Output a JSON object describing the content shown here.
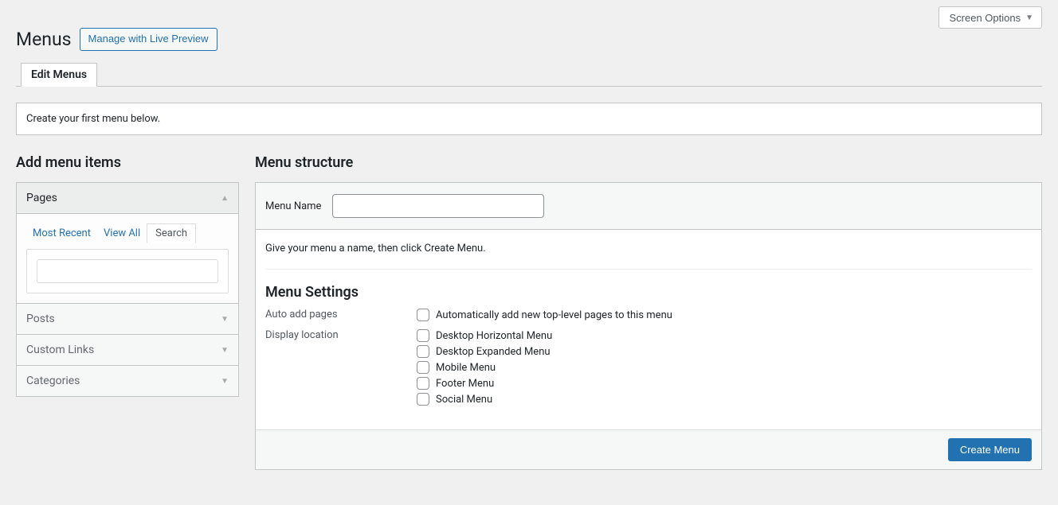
{
  "screen_options": {
    "label": "Screen Options"
  },
  "page": {
    "title": "Menus",
    "live_preview_button": "Manage with Live Preview"
  },
  "tabs": {
    "edit": "Edit Menus"
  },
  "notice": "Create your first menu below.",
  "left": {
    "title": "Add menu items",
    "pages": {
      "label": "Pages",
      "inner_tabs": {
        "recent": "Most Recent",
        "view_all": "View All",
        "search": "Search"
      },
      "search_value": ""
    },
    "posts": {
      "label": "Posts"
    },
    "custom_links": {
      "label": "Custom Links"
    },
    "categories": {
      "label": "Categories"
    }
  },
  "right": {
    "title": "Menu structure",
    "menu_name_label": "Menu Name",
    "menu_name_value": "",
    "hint": "Give your menu a name, then click Create Menu.",
    "settings_title": "Menu Settings",
    "auto_add_label": "Auto add pages",
    "auto_add_option": "Automatically add new top-level pages to this menu",
    "display_location_label": "Display location",
    "locations": [
      "Desktop Horizontal Menu",
      "Desktop Expanded Menu",
      "Mobile Menu",
      "Footer Menu",
      "Social Menu"
    ],
    "create_button": "Create Menu"
  }
}
